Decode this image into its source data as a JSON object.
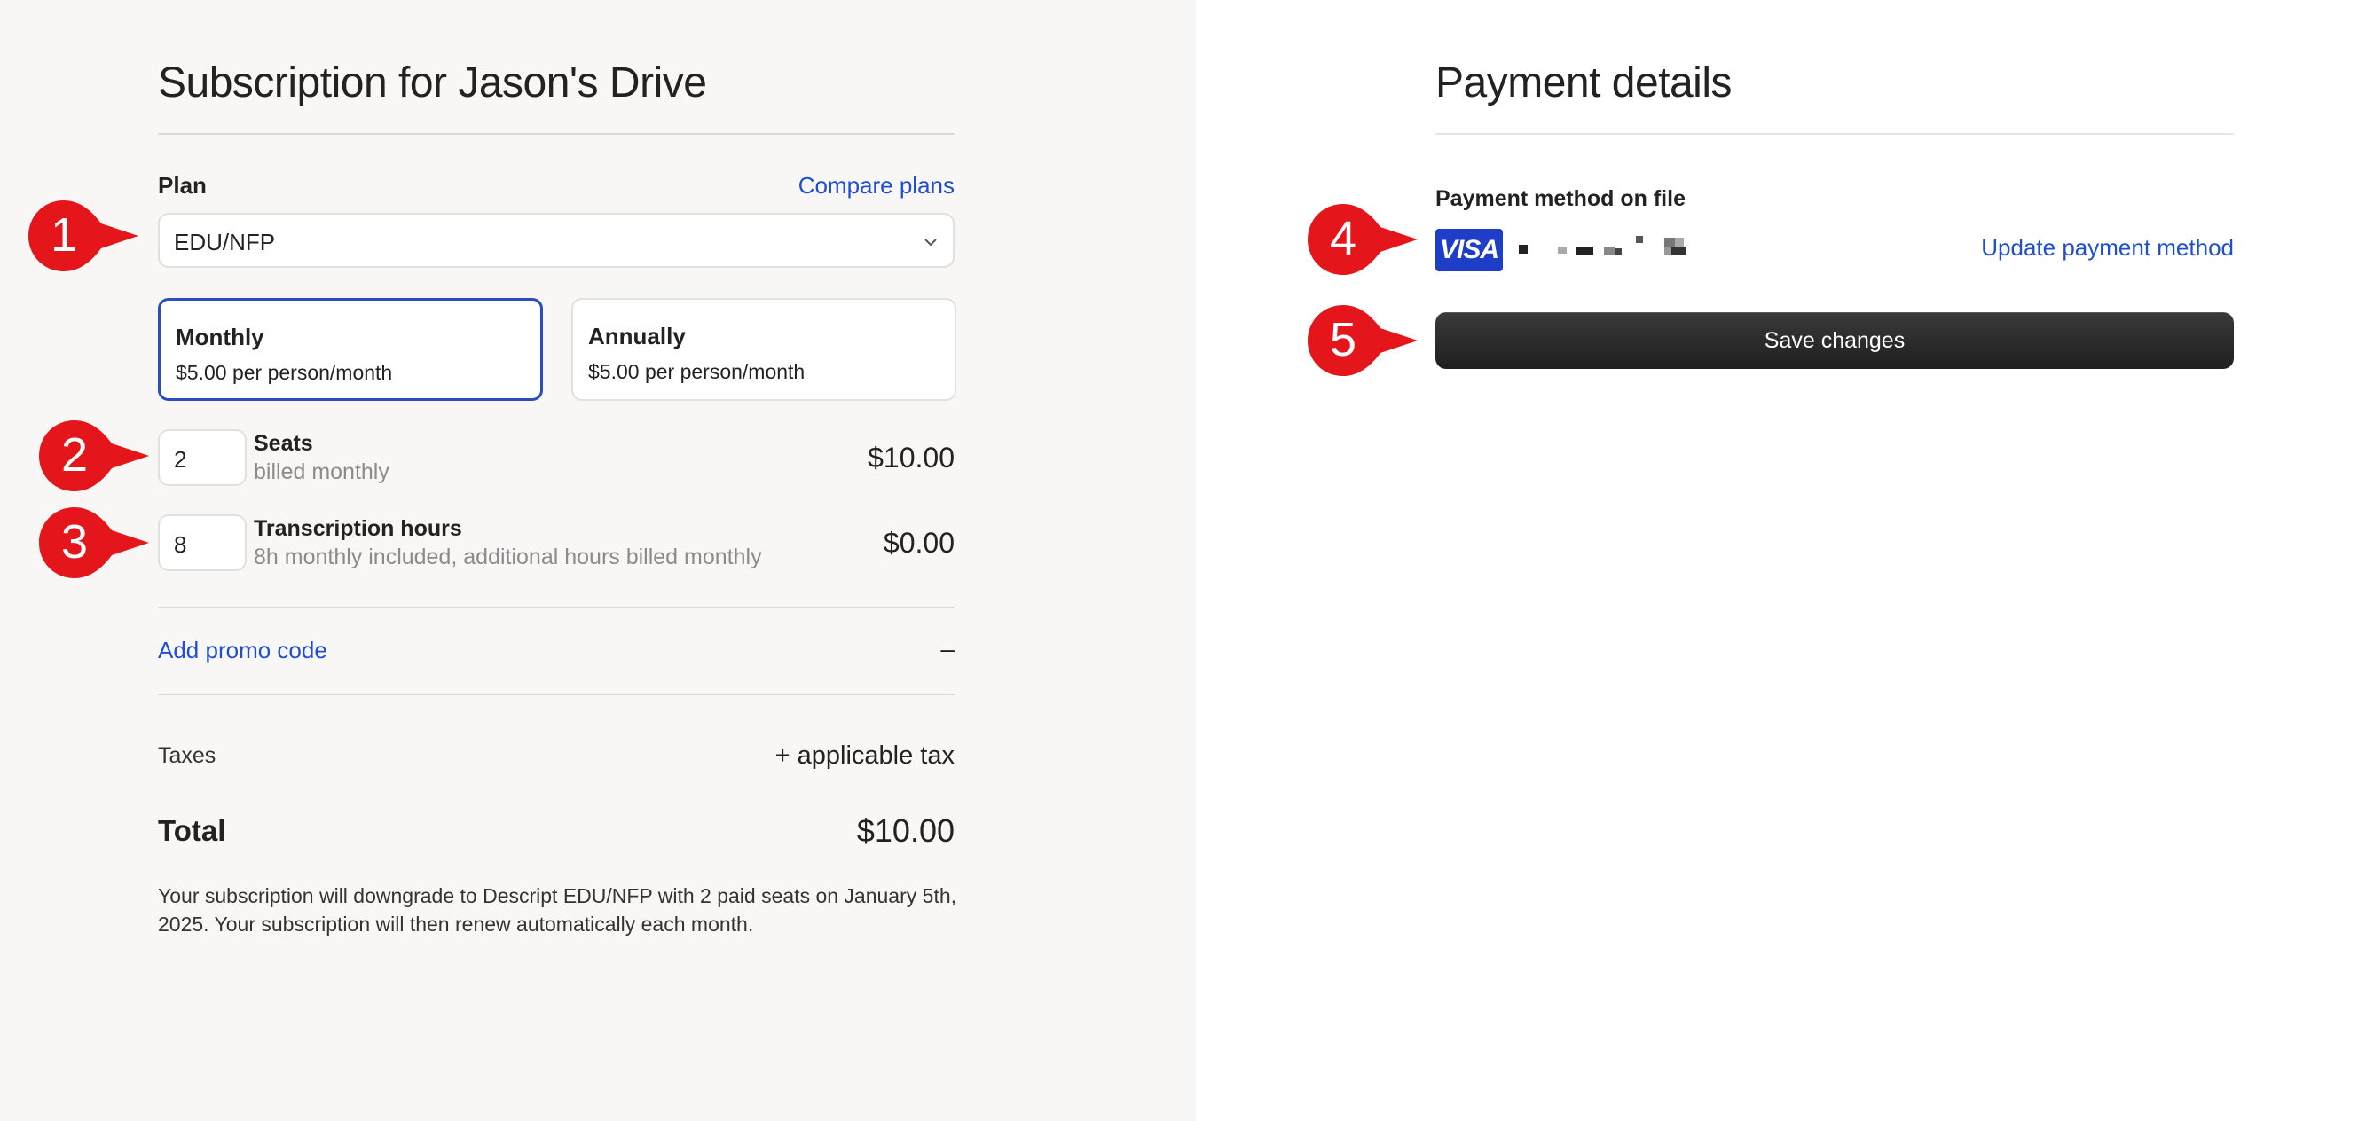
{
  "subscription": {
    "title": "Subscription for Jason's Drive",
    "plan_label": "Plan",
    "compare_plans_link": "Compare plans",
    "plan_select_value": "EDU/NFP",
    "billing_options": [
      {
        "name": "Monthly",
        "price": "$5.00 per person/month",
        "selected": true
      },
      {
        "name": "Annually",
        "price": "$5.00 per person/month",
        "selected": false
      }
    ],
    "seats": {
      "value": "2",
      "title": "Seats",
      "subtitle": "billed monthly",
      "price": "$10.00"
    },
    "transcription": {
      "value": "8",
      "title": "Transcription hours",
      "subtitle": "8h monthly included, additional hours billed monthly",
      "price": "$0.00"
    },
    "promo_link": "Add promo code",
    "promo_value": "–",
    "taxes_label": "Taxes",
    "taxes_value": "+ applicable tax",
    "total_label": "Total",
    "total_value": "$10.00",
    "note": "Your subscription will downgrade to Descript EDU/NFP with 2 paid seats on January 5th, 2025. Your subscription will then renew automatically each month."
  },
  "payment": {
    "title": "Payment details",
    "method_label": "Payment method on file",
    "card_brand": "VISA",
    "update_link": "Update payment method",
    "save_button": "Save changes"
  },
  "markers": [
    "1",
    "2",
    "3",
    "4",
    "5"
  ],
  "colors": {
    "marker_red": "#e4151b",
    "link_blue": "#1f4fd1",
    "selected_border": "#2a4ec2",
    "visa_blue": "#1f3ec7"
  }
}
